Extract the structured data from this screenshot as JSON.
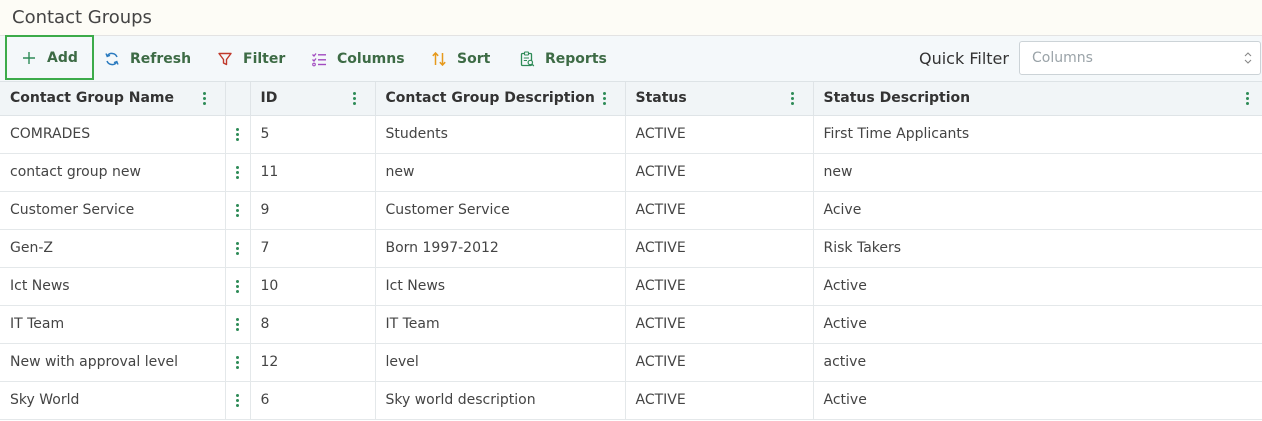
{
  "page": {
    "title": "Contact Groups"
  },
  "toolbar": {
    "add_label": "Add",
    "refresh_label": "Refresh",
    "filter_label": "Filter",
    "columns_label": "Columns",
    "sort_label": "Sort",
    "reports_label": "Reports",
    "quick_filter_label": "Quick Filter",
    "quick_filter_placeholder": "Columns"
  },
  "colors": {
    "accent_green": "#2e8b57",
    "add_border": "#3cab4a",
    "icon_blue": "#2b7bbf",
    "icon_red": "#c0392b",
    "icon_purple": "#a24bc0",
    "icon_orange": "#e69a1c"
  },
  "table": {
    "headers": {
      "name": "Contact Group Name",
      "id": "ID",
      "description": "Contact Group Description",
      "status": "Status",
      "status_description": "Status Description"
    },
    "rows": [
      {
        "name": "COMRADES",
        "id": "5",
        "description": "Students",
        "status": "ACTIVE",
        "status_description": "First Time Applicants"
      },
      {
        "name": "contact group new",
        "id": "11",
        "description": "new",
        "status": "ACTIVE",
        "status_description": "new"
      },
      {
        "name": "Customer Service",
        "id": "9",
        "description": "Customer Service",
        "status": "ACTIVE",
        "status_description": "Acive"
      },
      {
        "name": "Gen-Z",
        "id": "7",
        "description": "Born 1997-2012",
        "status": "ACTIVE",
        "status_description": "Risk Takers"
      },
      {
        "name": "Ict News",
        "id": "10",
        "description": "Ict News",
        "status": "ACTIVE",
        "status_description": "Active"
      },
      {
        "name": "IT Team",
        "id": "8",
        "description": "IT Team",
        "status": "ACTIVE",
        "status_description": "Active"
      },
      {
        "name": "New with approval level",
        "id": "12",
        "description": "level",
        "status": "ACTIVE",
        "status_description": "active"
      },
      {
        "name": "Sky World",
        "id": "6",
        "description": "Sky world description",
        "status": "ACTIVE",
        "status_description": "Active"
      }
    ]
  }
}
